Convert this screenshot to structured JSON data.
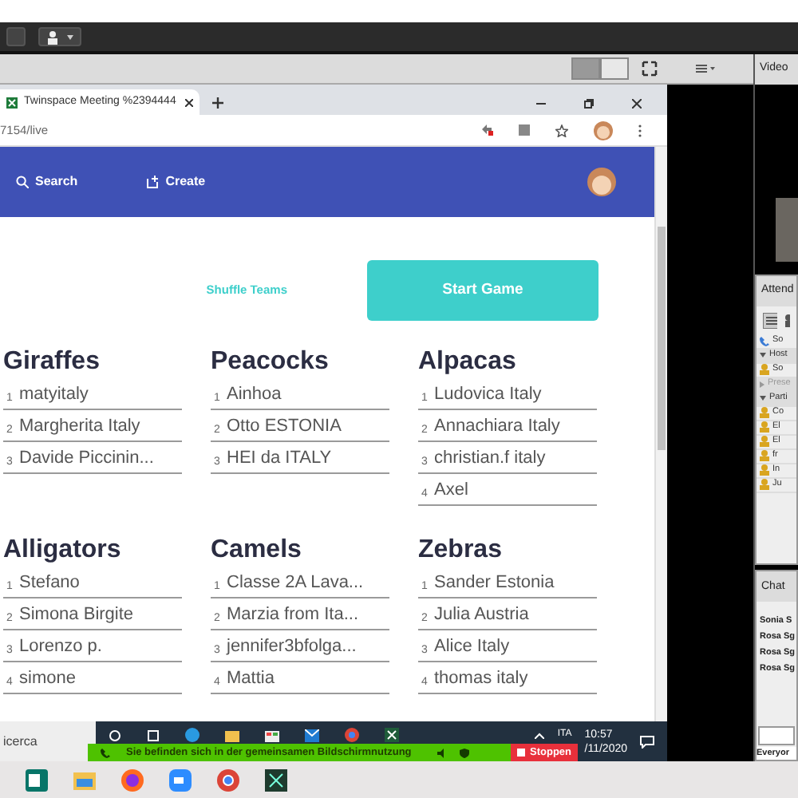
{
  "share_pod": {
    "layout_buttons": [
      {
        "selected": true
      },
      {
        "selected": false
      }
    ]
  },
  "video_pod": {
    "title": "Video"
  },
  "browser": {
    "tab_title": "Twinspace Meeting %2394444",
    "address": "7154/live"
  },
  "app_header": {
    "nav": [
      {
        "label": "Search",
        "kind": "search"
      },
      {
        "label": "Create",
        "kind": "create"
      }
    ]
  },
  "actions": {
    "shuffle": "Shuffle Teams",
    "start": "Start Game"
  },
  "teams": [
    {
      "name": "Giraffes",
      "members": [
        {
          "number": "1",
          "name": "matyitaly"
        },
        {
          "number": "2",
          "name": "Margherita Italy"
        },
        {
          "number": "3",
          "name": "Davide Piccinin..."
        }
      ]
    },
    {
      "name": "Peacocks",
      "members": [
        {
          "number": "1",
          "name": "Ainhoa"
        },
        {
          "number": "2",
          "name": "Otto ESTONIA"
        },
        {
          "number": "3",
          "name": "HEI da ITALY"
        }
      ]
    },
    {
      "name": "Alpacas",
      "members": [
        {
          "number": "1",
          "name": "Ludovica Italy"
        },
        {
          "number": "2",
          "name": "Annachiara Italy"
        },
        {
          "number": "3",
          "name": "christian.f italy"
        },
        {
          "number": "4",
          "name": "Axel"
        }
      ]
    },
    {
      "name": "Alligators",
      "members": [
        {
          "number": "1",
          "name": "Stefano"
        },
        {
          "number": "2",
          "name": "Simona Birgite"
        },
        {
          "number": "3",
          "name": "Lorenzo p."
        },
        {
          "number": "4",
          "name": "simone"
        }
      ]
    },
    {
      "name": "Camels",
      "members": [
        {
          "number": "1",
          "name": "Classe 2A Lava..."
        },
        {
          "number": "2",
          "name": "Marzia from Ita..."
        },
        {
          "number": "3",
          "name": "jennifer3bfolga..."
        },
        {
          "number": "4",
          "name": "Mattia"
        }
      ]
    },
    {
      "name": "Zebras",
      "members": [
        {
          "number": "1",
          "name": "Sander Estonia"
        },
        {
          "number": "2",
          "name": "Julia Austria"
        },
        {
          "number": "3",
          "name": "Alice Italy"
        },
        {
          "number": "4",
          "name": "thomas italy"
        }
      ]
    }
  ],
  "taskbar": {
    "search_text": "icerca",
    "language": "ITA",
    "time": "10:57",
    "date": "/11/2020"
  },
  "sharing_bar": {
    "message": "Sie befinden sich in der gemeinsamen Bildschirmnutzung",
    "stop_label": "Stoppen"
  },
  "attendees_pod": {
    "title": "Attend",
    "speaker": "So",
    "sections": [
      {
        "label": "Host",
        "expanded": true,
        "people": [
          "So"
        ]
      },
      {
        "label": "Prese",
        "expanded": false
      },
      {
        "label": "Parti",
        "expanded": true,
        "people": [
          "Co",
          "El",
          "El",
          "fr",
          "In",
          "Ju"
        ]
      }
    ]
  },
  "chat_pod": {
    "title": "Chat",
    "messages": [
      "Sonia S",
      "Rosa Sg",
      "Rosa Sg",
      "Rosa Sg"
    ],
    "recipient": "Everyor"
  }
}
